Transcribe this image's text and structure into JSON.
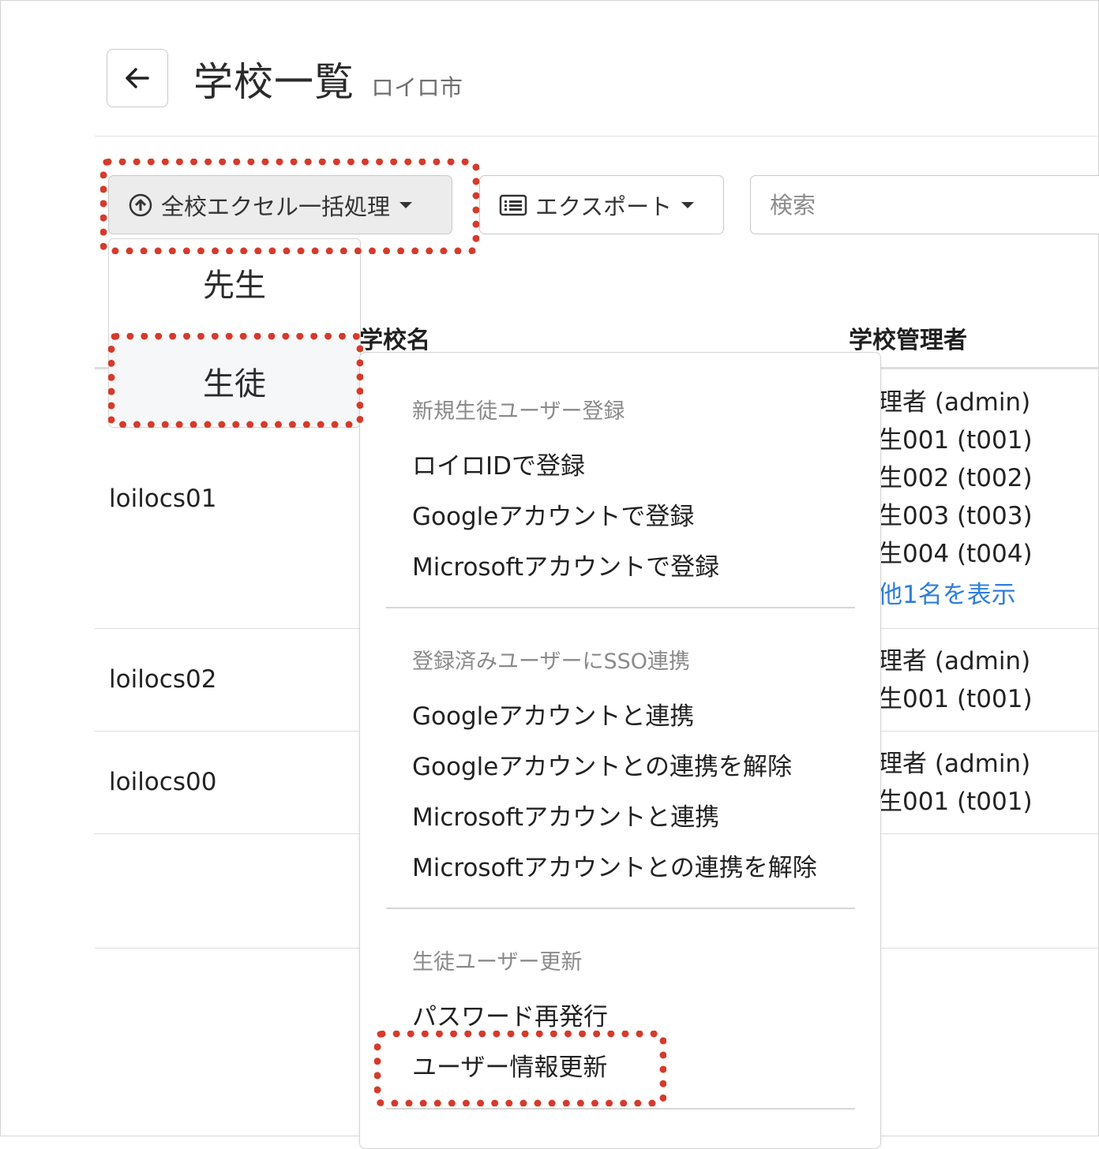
{
  "header": {
    "title": "学校一覧",
    "subtitle": "ロイロ市",
    "back_icon": "arrow-left-icon"
  },
  "toolbar": {
    "bulk_button_label": "全校エクセル一括処理",
    "bulk_icon": "upload-circle-icon",
    "export_button_label": "エクスポート",
    "export_icon": "list-icon",
    "search_placeholder": "検索"
  },
  "role_menu": {
    "items": [
      "先生",
      "生徒"
    ],
    "selected": "生徒"
  },
  "table": {
    "columns": [
      "学校名",
      "学校管理者"
    ],
    "rows": [
      {
        "id": "loilocs01",
        "admins": [
          "理者 (admin)",
          "生001 (t001)",
          "生002 (t002)",
          "生003 (t003)",
          "生004 (t004)"
        ],
        "show_more": "他1名を表示"
      },
      {
        "id": "loilocs02",
        "admins": [
          "理者 (admin)",
          "生001 (t001)"
        ]
      },
      {
        "id": "loilocs00",
        "admins": [
          "理者 (admin)",
          "生001 (t001)"
        ]
      }
    ]
  },
  "submenu": {
    "sections": [
      {
        "header": "新規生徒ユーザー登録",
        "items": [
          "ロイロIDで登録",
          "Googleアカウントで登録",
          "Microsoftアカウントで登録"
        ]
      },
      {
        "header": "登録済みユーザーにSSO連携",
        "items": [
          "Googleアカウントと連携",
          "Googleアカウントとの連携を解除",
          "Microsoftアカウントと連携",
          "Microsoftアカウントとの連携を解除"
        ]
      },
      {
        "header": "生徒ユーザー更新",
        "items": [
          "パスワード再発行",
          "ユーザー情報更新"
        ]
      }
    ]
  },
  "colors": {
    "callout": "#d63a2a",
    "link": "#2f7fd9",
    "section_header": "#8a8a8a"
  }
}
